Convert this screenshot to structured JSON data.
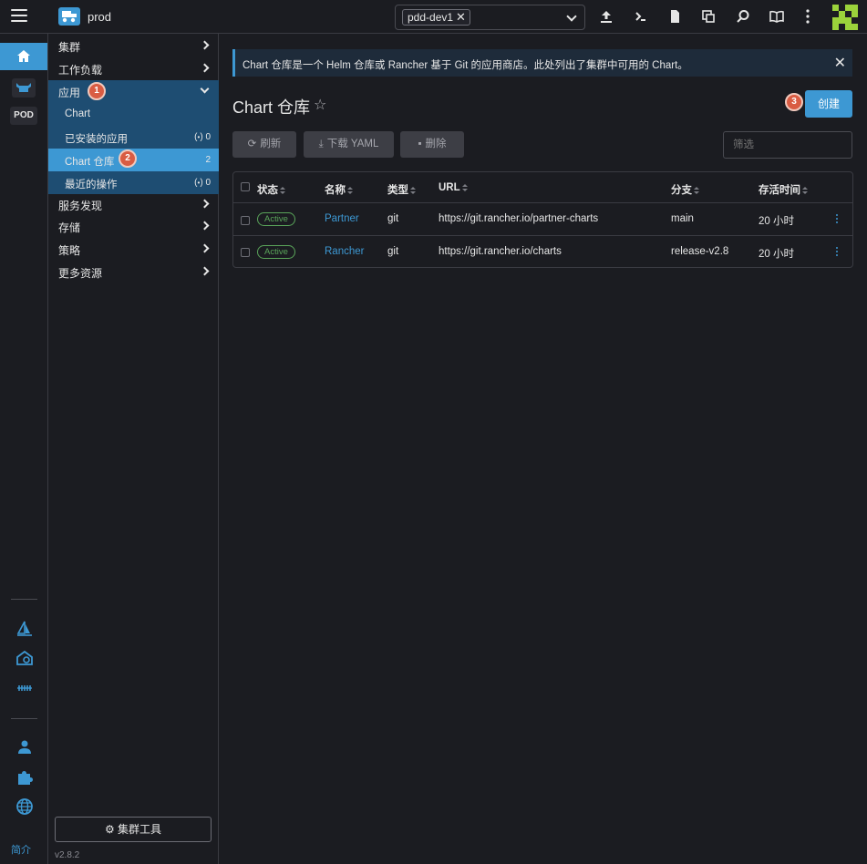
{
  "header": {
    "cluster_name": "prod",
    "namespace_chip": "pdd-dev1",
    "namespace_chip_close": "✕",
    "avatar_color": "#9bd33b"
  },
  "rail": {
    "pod_label": "POD",
    "intro_label": "简介",
    "accent": "#3d98d3"
  },
  "sidenav": {
    "groups": [
      {
        "label": "集群"
      },
      {
        "label": "工作负载"
      },
      {
        "label": "应用"
      },
      {
        "label": "服务发现"
      },
      {
        "label": "存储"
      },
      {
        "label": "策略"
      },
      {
        "label": "更多资源"
      }
    ],
    "sub_items": [
      {
        "label": "Chart",
        "count": ""
      },
      {
        "label": "已安装的应用",
        "count": "0"
      },
      {
        "label": "Chart 仓库",
        "count": "2"
      },
      {
        "label": "最近的操作",
        "count": "0"
      }
    ],
    "cluster_tools": "集群工具",
    "version": "v2.8.2"
  },
  "steps": [
    "1",
    "2",
    "3"
  ],
  "banner": {
    "text": "Chart 仓库是一个 Helm 仓库或 Rancher 基于 Git 的应用商店。此处列出了集群中可用的 Chart。",
    "close": "✕"
  },
  "page": {
    "title": "Chart 仓库",
    "create_label": "创建",
    "toolbar": {
      "refresh": "刷新",
      "download_yaml": "下载 YAML",
      "delete": "删除"
    },
    "filter_placeholder": "筛选"
  },
  "table": {
    "columns": [
      "状态",
      "名称",
      "类型",
      "URL",
      "分支",
      "存活时间"
    ],
    "rows": [
      {
        "status": "Active",
        "name": "Partner",
        "type": "git",
        "url": "https://git.rancher.io/partner-charts",
        "branch": "main",
        "age": "20 小时"
      },
      {
        "status": "Active",
        "name": "Rancher",
        "type": "git",
        "url": "https://git.rancher.io/charts",
        "branch": "release-v2.8",
        "age": "20 小时"
      }
    ]
  }
}
